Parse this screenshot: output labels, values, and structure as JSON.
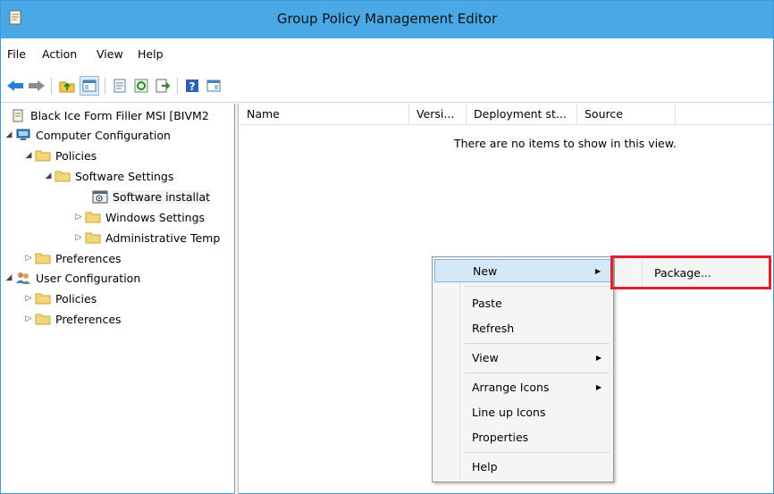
{
  "window": {
    "title": "Group Policy Management Editor"
  },
  "menubar": {
    "items": [
      "File",
      "Action",
      "View",
      "Help"
    ]
  },
  "toolbar": {
    "buttons": [
      "back-icon",
      "forward-icon",
      "up-folder-icon",
      "show-hide-tree-icon",
      "properties-icon",
      "refresh-icon",
      "export-list-icon",
      "help-icon",
      "show-action-pane-icon"
    ]
  },
  "tree": {
    "root": "Black Ice Form Filler MSI [BIVM2",
    "nodes": [
      {
        "label": "Computer Configuration",
        "expander": "◢"
      },
      {
        "label": "Policies",
        "expander": "◢"
      },
      {
        "label": "Software Settings",
        "expander": "◢"
      },
      {
        "label": "Software installat",
        "expander": ""
      },
      {
        "label": "Windows Settings",
        "expander": "▷"
      },
      {
        "label": "Administrative Temp",
        "expander": "▷"
      },
      {
        "label": "Preferences",
        "expander": "▷"
      },
      {
        "label": "User Configuration",
        "expander": "◢"
      },
      {
        "label": "Policies",
        "expander": "▷"
      },
      {
        "label": "Preferences",
        "expander": "▷"
      }
    ]
  },
  "list": {
    "columns": [
      "Name",
      "Versi...",
      "Deployment st...",
      "Source"
    ],
    "empty_message": "There are no items to show in this view."
  },
  "context_menu": {
    "items": [
      {
        "label": "New",
        "submenu": true,
        "highlighted": true
      },
      {
        "label": "Paste"
      },
      {
        "label": "Refresh"
      },
      {
        "label": "View",
        "submenu": true
      },
      {
        "label": "Arrange Icons",
        "submenu": true
      },
      {
        "label": "Line up Icons"
      },
      {
        "label": "Properties"
      },
      {
        "label": "Help"
      }
    ],
    "submenu_arrow": "▶"
  },
  "submenu": {
    "items": [
      {
        "label": "Package..."
      }
    ]
  },
  "colors": {
    "titlebar": "#4aa8e6",
    "highlight": "#d5e8f7",
    "annotation": "#e0202a"
  }
}
